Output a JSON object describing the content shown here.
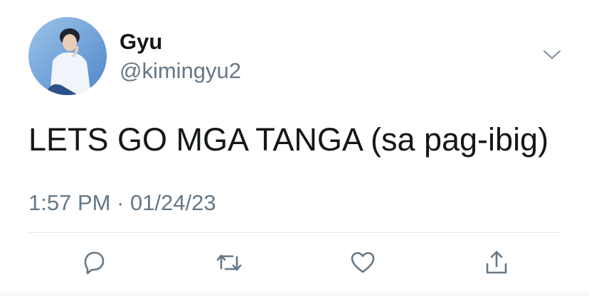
{
  "tweet": {
    "author": {
      "display_name": "Gyu",
      "handle": "@kimingyu2"
    },
    "text": "LETS GO MGA TANGA (sa pag-ibig)",
    "timestamp": "1:57 PM · 01/24/23"
  },
  "icons": {
    "menu": "chevron-down-icon",
    "reply": "reply-icon",
    "retweet": "retweet-icon",
    "like": "heart-icon",
    "share": "share-icon"
  },
  "colors": {
    "text_primary": "#14171a",
    "text_secondary": "#657786",
    "icon": "#657786",
    "divider": "#e1e8ed"
  }
}
